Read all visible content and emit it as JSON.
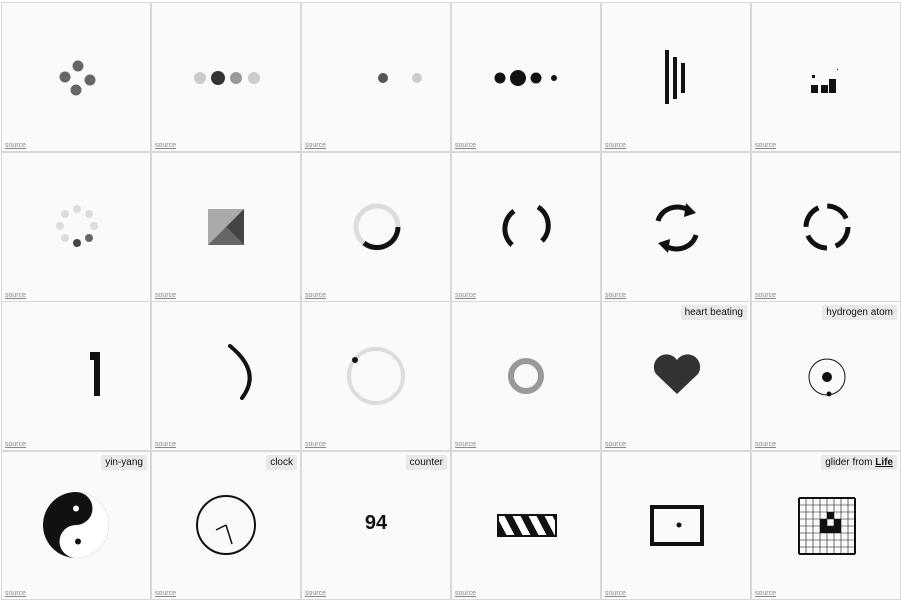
{
  "source_label": "source",
  "labels": {
    "heart": "heart beating",
    "hydrogen": "hydrogen atom",
    "yinyang": "yin-yang",
    "clock": "clock",
    "counter": "counter",
    "glider_prefix": "glider from ",
    "glider_link": "Life"
  },
  "counter_value": "94",
  "colors": {
    "dark": "#111111",
    "mid": "#555555",
    "light": "#cccccc",
    "grey": "#999999"
  }
}
